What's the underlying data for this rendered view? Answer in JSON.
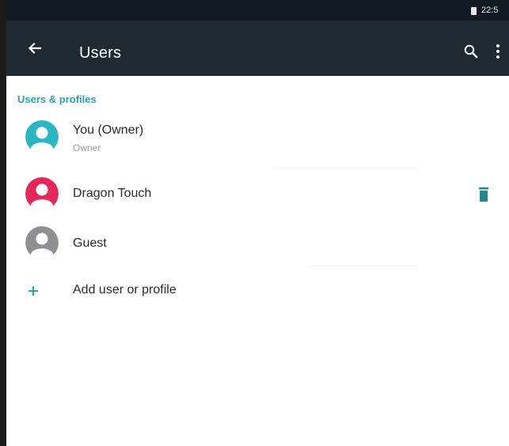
{
  "status_bar": {
    "time": "22:5",
    "battery_icon": "battery-icon"
  },
  "app_bar": {
    "title": "Users",
    "back_icon": "back-arrow-icon",
    "search_icon": "search-icon",
    "more_icon": "more-vert-icon",
    "background": "#1f2a33"
  },
  "section": {
    "header": "Users & profiles",
    "accent_color": "#2aa3ad"
  },
  "users": [
    {
      "name": "You (Owner)",
      "subtitle": "Owner",
      "avatar_color": "#2bb6c4",
      "icon": "user-avatar-icon"
    },
    {
      "name": "Dragon Touch",
      "subtitle": "",
      "avatar_color": "#e5285a",
      "icon": "user-avatar-icon",
      "action_icon": "delete-icon",
      "action_color": "#1f8a8a"
    },
    {
      "name": "Guest",
      "subtitle": "",
      "avatar_color": "#8f8f93",
      "icon": "user-avatar-icon"
    }
  ],
  "add_item": {
    "label": "Add user or profile",
    "icon": "plus-icon",
    "icon_color": "#2aa3ad"
  }
}
